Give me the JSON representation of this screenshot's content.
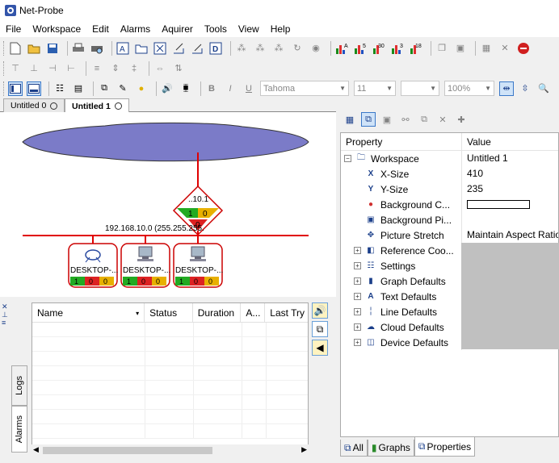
{
  "app": {
    "title": "Net-Probe"
  },
  "menu": [
    "File",
    "Workspace",
    "Edit",
    "Alarms",
    "Aquirer",
    "Tools",
    "View",
    "Help"
  ],
  "format_toolbar": {
    "font": "Tahoma",
    "size": "11",
    "zoom": "100%",
    "bold": "B",
    "italic": "I",
    "underline": "U"
  },
  "toolbar_graph_labels": [
    "A",
    "5",
    "30",
    "3",
    "18"
  ],
  "doc_tabs": [
    "Untitled 0",
    "Untitled 1"
  ],
  "diagram": {
    "router_label": "..10.1",
    "router_counts": [
      "1",
      "0",
      "0"
    ],
    "network_label": "192.168.10.0 (255.255.255.",
    "devices": [
      {
        "label": "DESKTOP-...",
        "counts": [
          "1",
          "0",
          "0"
        ]
      },
      {
        "label": "DESKTOP-...",
        "counts": [
          "1",
          "0",
          "0"
        ]
      },
      {
        "label": "DESKTOP-...",
        "counts": [
          "1",
          "0",
          "0"
        ]
      }
    ],
    "colors": {
      "cloud": "#7b7bc8",
      "line": "#e00000",
      "ok": "#22aa22",
      "warn": "#e8b000",
      "crit": "#dd2222"
    }
  },
  "bottom": {
    "vtabs": [
      "Logs",
      "Alarms"
    ],
    "columns": [
      "Name",
      "Status",
      "Duration",
      "A...",
      "Last Try"
    ]
  },
  "properties": {
    "header": {
      "property": "Property",
      "value": "Value"
    },
    "rows": [
      {
        "name": "Workspace",
        "value": "Untitled 1",
        "expander": "−",
        "icon": "folder-icon",
        "indent": 0
      },
      {
        "name": "X-Size",
        "value": "410",
        "expander": "",
        "icon": "x-axis-icon",
        "indent": 1
      },
      {
        "name": "Y-Size",
        "value": "235",
        "expander": "",
        "icon": "y-axis-icon",
        "indent": 1
      },
      {
        "name": "Background C...",
        "value": "",
        "expander": "",
        "icon": "color-wheel-icon",
        "indent": 1
      },
      {
        "name": "Background Pi...",
        "value": "",
        "expander": "",
        "icon": "picture-icon",
        "indent": 1
      },
      {
        "name": "Picture Stretch",
        "value": "Maintain Aspect Ratio",
        "expander": "",
        "icon": "stretch-icon",
        "indent": 1
      },
      {
        "name": "Reference Coo...",
        "value": "",
        "expander": "+",
        "icon": "reference-icon",
        "indent": 1
      },
      {
        "name": "Settings",
        "value": "",
        "expander": "+",
        "icon": "settings-icon",
        "indent": 1
      },
      {
        "name": "Graph Defaults",
        "value": "",
        "expander": "+",
        "icon": "graph-icon",
        "indent": 1
      },
      {
        "name": "Text Defaults",
        "value": "",
        "expander": "+",
        "icon": "text-icon",
        "indent": 1
      },
      {
        "name": "Line Defaults",
        "value": "",
        "expander": "+",
        "icon": "line-icon",
        "indent": 1
      },
      {
        "name": "Cloud Defaults",
        "value": "",
        "expander": "+",
        "icon": "cloud-icon",
        "indent": 1
      },
      {
        "name": "Device Defaults",
        "value": "",
        "expander": "+",
        "icon": "device-icon",
        "indent": 1
      }
    ]
  },
  "panel_tabs": [
    "All",
    "Graphs",
    "Properties"
  ]
}
